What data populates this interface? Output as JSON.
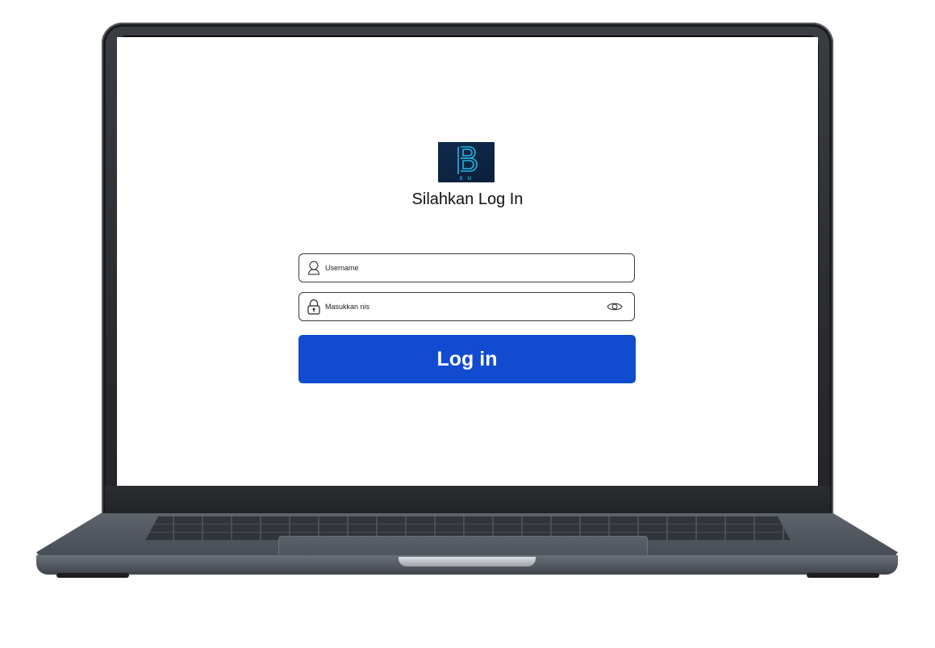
{
  "logo": {
    "monogram": "BM",
    "letters": "B M",
    "bg_color": "#0f2b4e",
    "line_color": "#22b8e8"
  },
  "page": {
    "title": "Silahkan Log In"
  },
  "form": {
    "username": {
      "placeholder": "Username",
      "value": "",
      "icon": "user-icon"
    },
    "password": {
      "placeholder": "Masukkan nis",
      "value": "",
      "icon": "lock-icon",
      "toggle_icon": "eye-icon"
    },
    "submit_label": "Log in"
  },
  "colors": {
    "accent": "#114bd0",
    "field_border": "#3b3b3b"
  }
}
